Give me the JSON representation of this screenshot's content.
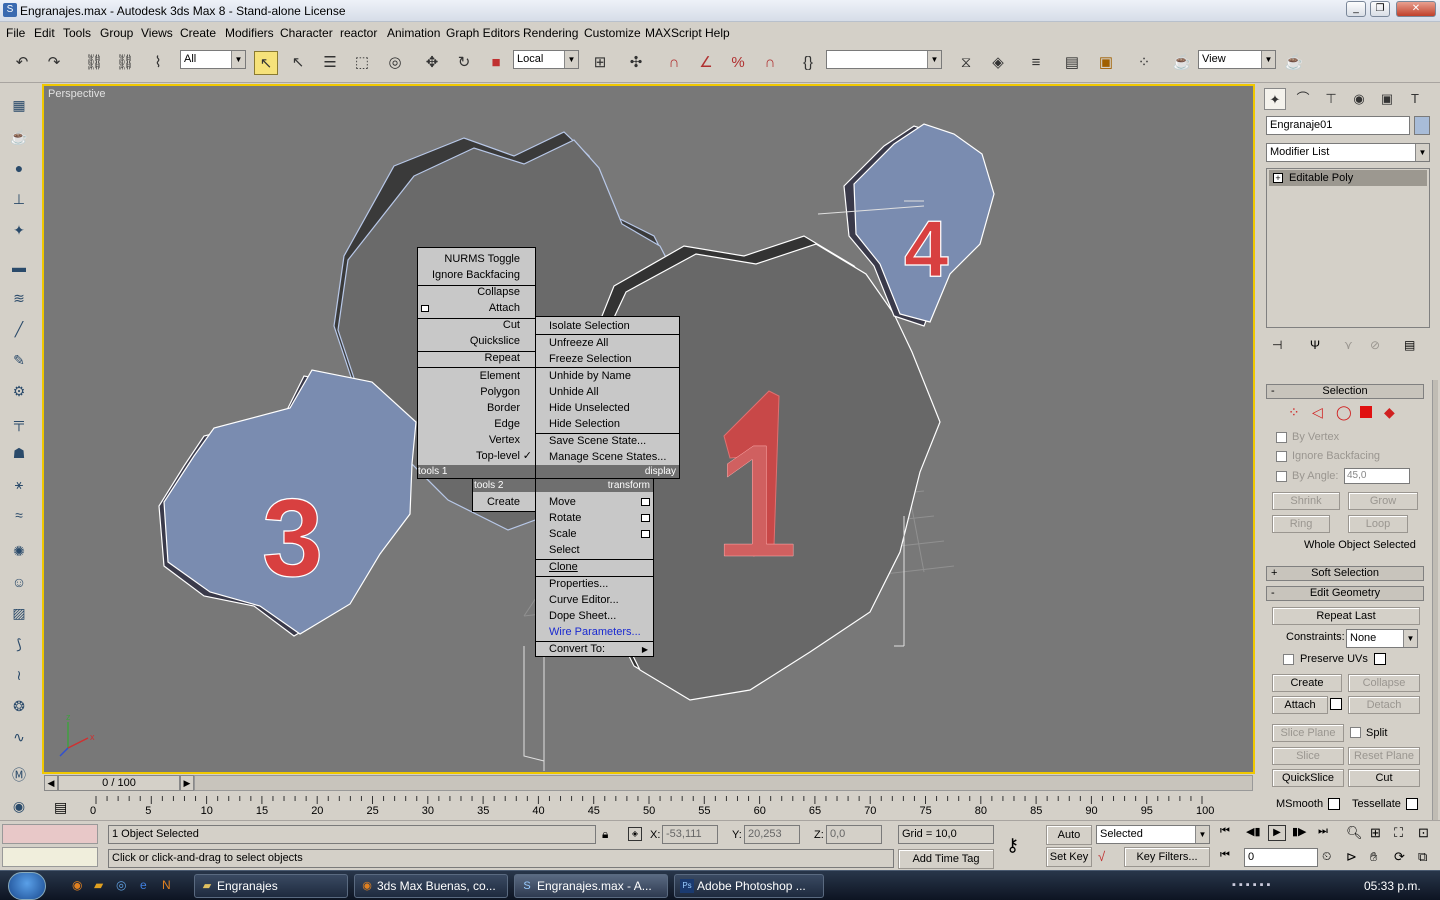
{
  "window": {
    "title": "Engranajes.max - Autodesk 3ds Max 8   - Stand-alone License"
  },
  "menu": [
    "File",
    "Edit",
    "Tools",
    "Group",
    "Views",
    "Create",
    "Modifiers",
    "Character",
    "reactor",
    "Animation",
    "Graph Editors",
    "Rendering",
    "Customize",
    "MAXScript",
    "Help"
  ],
  "toolbar": {
    "selection_filter": "All",
    "ref_coord": "Local",
    "named_sel": "",
    "view_combo": "View"
  },
  "viewport": {
    "label": "Perspective",
    "gear_labels": [
      "1",
      "3",
      "4"
    ],
    "axis_labels": {
      "z": "z",
      "x": "x"
    }
  },
  "quadmenu": {
    "tools1": {
      "items": [
        "NURMS Toggle",
        "Ignore Backfacing",
        "Collapse",
        "Attach",
        "Cut",
        "Quickslice",
        "Repeat",
        "Element",
        "Polygon",
        "Border",
        "Edge",
        "Vertex",
        "Top-level"
      ],
      "header_left": "tools 1",
      "header_right": "display",
      "check": "✓"
    },
    "display": {
      "items": [
        "Isolate Selection",
        "Unfreeze All",
        "Freeze Selection",
        "Unhide by Name",
        "Unhide All",
        "Hide Unselected",
        "Hide Selection",
        "Save Scene State...",
        "Manage Scene States..."
      ]
    },
    "tools2": {
      "header_left": "tools 2",
      "items": [
        "Create"
      ]
    },
    "transform": {
      "header_right": "transform",
      "items": [
        "Move",
        "Rotate",
        "Scale",
        "Select",
        "Clone",
        "Properties...",
        "Curve Editor...",
        "Dope Sheet...",
        "Wire Parameters...",
        "Convert To:"
      ]
    }
  },
  "panel": {
    "object_name": "Engranaje01",
    "modifier_list": "Modifier List",
    "stack_item": "Editable Poly",
    "selection": {
      "title": "Selection",
      "by_vertex": "By Vertex",
      "ignore_backfacing": "Ignore Backfacing",
      "by_angle": "By Angle:",
      "angle_value": "45,0",
      "shrink": "Shrink",
      "grow": "Grow",
      "ring": "Ring",
      "loop": "Loop",
      "status": "Whole Object Selected"
    },
    "soft_selection": {
      "title": "Soft Selection"
    },
    "edit_geometry": {
      "title": "Edit Geometry",
      "repeat_last": "Repeat Last",
      "constraints_label": "Constraints:",
      "constraints_value": "None",
      "preserve_uvs": "Preserve UVs",
      "create": "Create",
      "collapse": "Collapse",
      "attach": "Attach",
      "detach": "Detach",
      "slice_plane": "Slice Plane",
      "split": "Split",
      "slice": "Slice",
      "reset_plane": "Reset Plane",
      "quickslice": "QuickSlice",
      "cut": "Cut",
      "msmooth": "MSmooth",
      "tessellate": "Tessellate"
    }
  },
  "timeline": {
    "frame": "0 / 100",
    "ticks": [
      "0",
      "5",
      "10",
      "15",
      "20",
      "25",
      "30",
      "35",
      "40",
      "45",
      "50",
      "55",
      "60",
      "65",
      "70",
      "75",
      "80",
      "85",
      "90",
      "95",
      "100"
    ]
  },
  "status": {
    "selected": "1 Object Selected",
    "prompt": "Click or click-and-drag to select objects",
    "x_label": "X:",
    "x": "-53,111",
    "y_label": "Y:",
    "y": "20,253",
    "z_label": "Z:",
    "z": "0,0",
    "grid": "Grid = 10,0",
    "add_time_tag": "Add Time Tag",
    "auto_key": "Auto Key",
    "set_key": "Set Key",
    "key_mode": "Selected",
    "key_filters": "Key Filters...",
    "frame_spinner": "0"
  },
  "taskbar": {
    "items": [
      "Engranajes",
      "3ds Max Buenas, co...",
      "Engranajes.max - A...",
      "Adobe Photoshop ..."
    ],
    "clock": "05:33 p.m."
  }
}
